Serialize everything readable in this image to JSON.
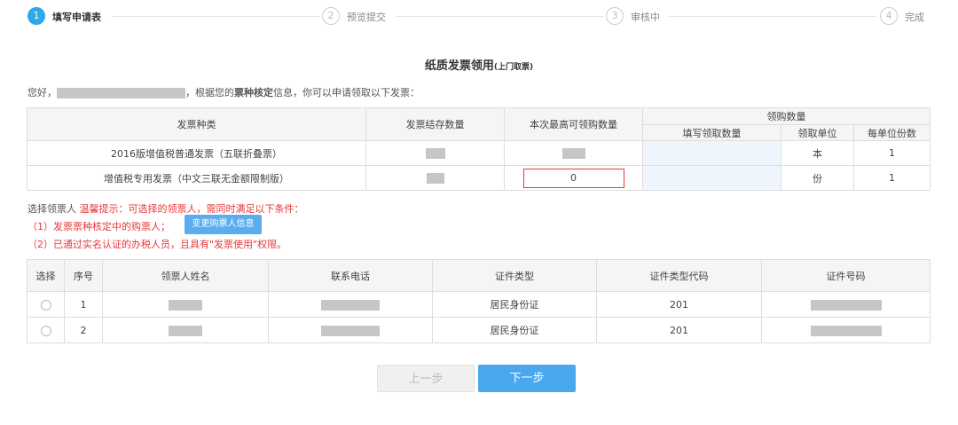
{
  "steps": [
    {
      "num": "1",
      "label": "填写申请表"
    },
    {
      "num": "2",
      "label": "预览提交"
    },
    {
      "num": "3",
      "label": "审核中"
    },
    {
      "num": "4",
      "label": "完成"
    }
  ],
  "title": "纸质发票领用",
  "title_sub": "(上门取票)",
  "greeting": {
    "prefix": "您好，",
    "middle": "，根据您的",
    "bold": "票种核定",
    "suffix": "信息，你可以申请领取以下发票："
  },
  "invoice_table": {
    "headers": {
      "type": "发票种类",
      "stock": "发票结存数量",
      "max": "本次最高可领购数量",
      "group": "领购数量",
      "fill": "填写领取数量",
      "unit": "领取单位",
      "per": "每单位份数"
    },
    "rows": [
      {
        "type": "2016版增值税普通发票（五联折叠票）",
        "unit": "本",
        "per": "1",
        "input": ""
      },
      {
        "type": "增值税专用发票（中文三联无金额限制版）",
        "unit": "份",
        "per": "1",
        "max_input": "0",
        "input": ""
      }
    ]
  },
  "recipient": {
    "label": "选择领票人",
    "tip": "温馨提示：可选择的领票人，需同时满足以下条件：",
    "cond1": "（1）发票票种核定中的购票人；",
    "change_button": "变更购票人信息",
    "cond2": "（2）已通过实名认证的办税人员，且具有\"发票使用\"权限。"
  },
  "people_table": {
    "headers": [
      "选择",
      "序号",
      "领票人姓名",
      "联系电话",
      "证件类型",
      "证件类型代码",
      "证件号码"
    ],
    "rows": [
      {
        "seq": "1",
        "id_type": "居民身份证",
        "code": "201"
      },
      {
        "seq": "2",
        "id_type": "居民身份证",
        "code": "201"
      }
    ]
  },
  "buttons": {
    "prev": "上一步",
    "next": "下一步"
  }
}
